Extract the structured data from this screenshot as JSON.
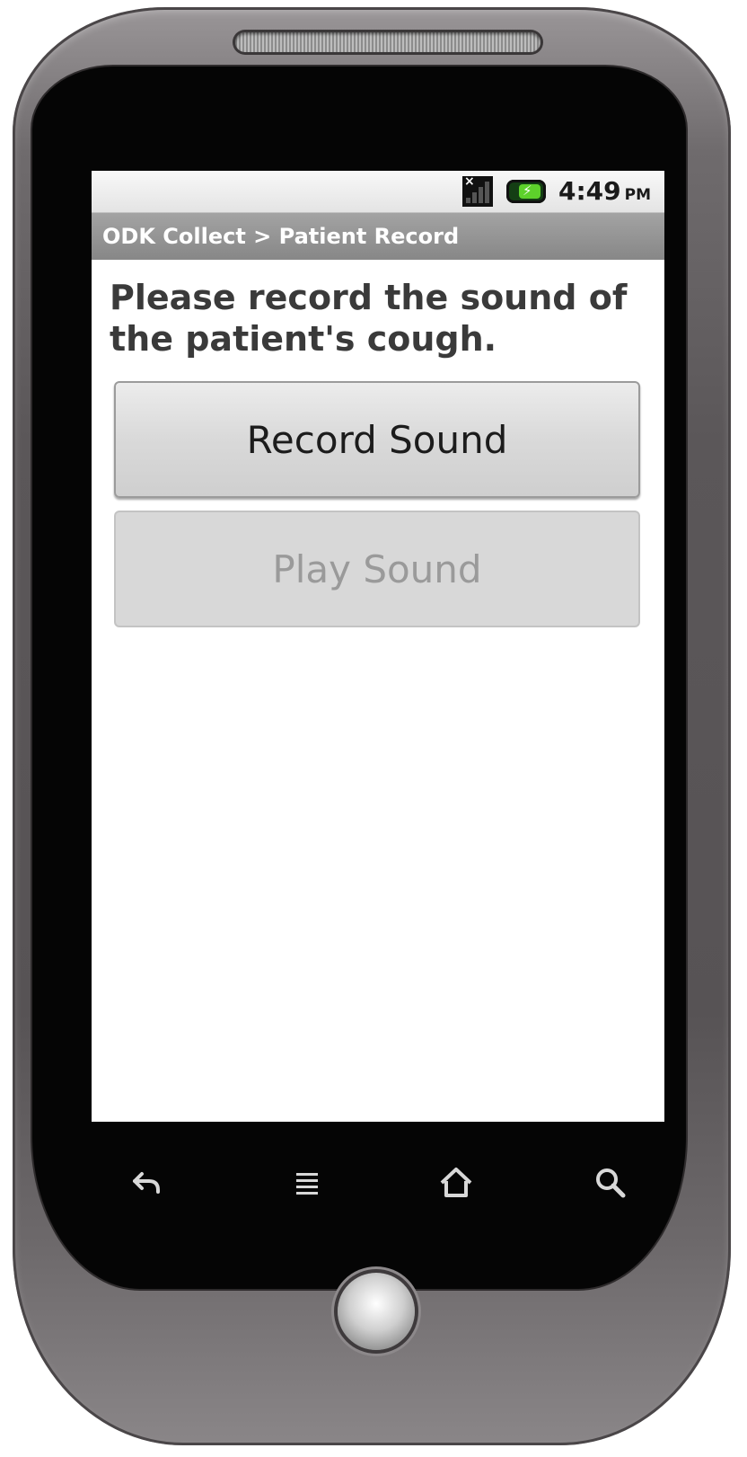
{
  "status_bar": {
    "time": "4:49",
    "ampm": "PM",
    "icons": [
      "signal-no-sim-icon",
      "battery-charging-icon"
    ]
  },
  "title_bar": {
    "title": "ODK Collect > Patient Record"
  },
  "question": {
    "text": "Please record the sound of the patient's cough."
  },
  "buttons": {
    "record_label": "Record Sound",
    "play_label": "Play Sound",
    "play_enabled": false
  },
  "nav_bar": {
    "icons": [
      "back-icon",
      "menu-icon",
      "home-icon",
      "search-icon"
    ]
  },
  "colors": {
    "title_bar_bg": "#8f8f8f",
    "battery_accent": "#5dd12b"
  }
}
